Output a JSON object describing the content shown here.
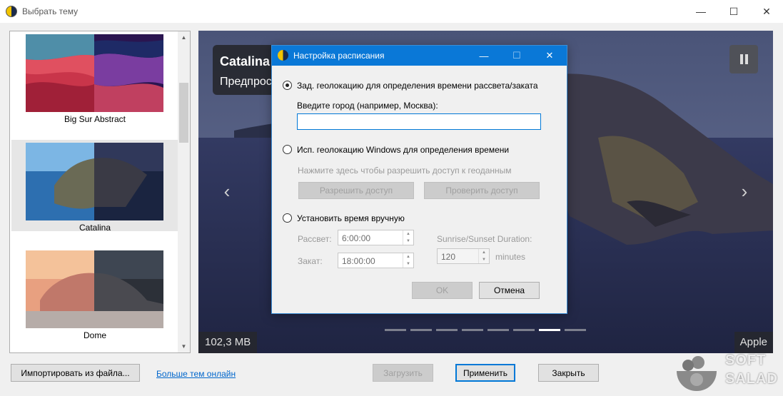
{
  "window": {
    "title": "Выбрать тему",
    "controls": {
      "minimize": "—",
      "maximize": "☐",
      "close": "✕"
    }
  },
  "theme_list": {
    "items": [
      {
        "label": "Big Sur Abstract",
        "selected": false
      },
      {
        "label": "Catalina",
        "selected": true
      },
      {
        "label": "Dome",
        "selected": false
      }
    ],
    "scroll_up": "▲",
    "scroll_down": "▼"
  },
  "preview": {
    "title": "Catalina",
    "subtitle": "Предпрос",
    "size": "102,3 MB",
    "author": "Apple",
    "pause_icon": "pause-icon",
    "prev_arrow": "‹",
    "next_arrow": "›",
    "slide_count": 8,
    "active_slide": 7
  },
  "footer": {
    "import_button": "Импортировать из файла...",
    "more_themes_link": "Больше тем онлайн",
    "download_button": "Загрузить",
    "apply_button": "Применить",
    "close_button": "Закрыть"
  },
  "watermark": {
    "line1": "SOFT",
    "line2": "SALAD"
  },
  "schedule_dialog": {
    "title": "Настройка расписания",
    "controls": {
      "minimize": "—",
      "maximize": "☐",
      "close": "✕"
    },
    "option_geolocation": "Зад. геолокацию для определения времени рассвета/заката",
    "city_label": "Введите город (например, Москва):",
    "city_value": "",
    "option_windows_geo": "Исп. геолокацию Windows для определения времени",
    "windows_geo_hint": "Нажмите здесь чтобы разрешить доступ к геоданным",
    "allow_access_button": "Разрешить доступ",
    "check_access_button": "Проверить доступ",
    "option_manual": "Установить время вручную",
    "sunrise_label": "Рассвет:",
    "sunrise_value": "6:00:00",
    "sunset_label": "Закат:",
    "sunset_value": "18:00:00",
    "duration_label": "Sunrise/Sunset Duration:",
    "duration_value": "120",
    "duration_unit": "minutes",
    "ok_button": "OK",
    "cancel_button": "Отмена",
    "selected_option": "geolocation"
  },
  "colors": {
    "accent": "#0078d7",
    "dialog_titlebar": "#0a78d7",
    "list_selected": "#e6e6e6",
    "link": "#0066cc"
  }
}
